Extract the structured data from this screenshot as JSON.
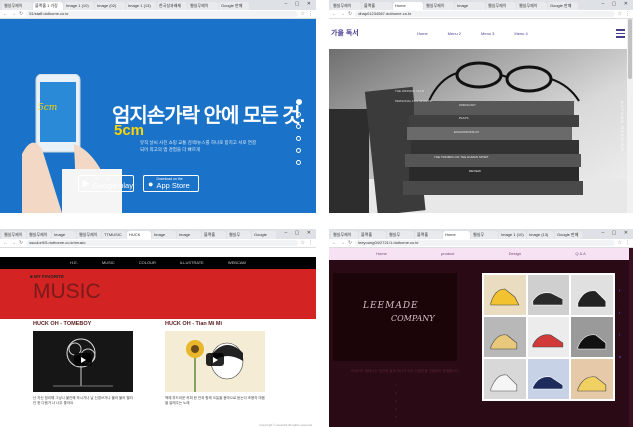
{
  "win1": {
    "tabs": [
      "웹실무제이",
      "블랙홀 1 가장",
      "Image 1 (10)",
      "Image (02)",
      "Image 1 (13)",
      "한국성과배제",
      "웹실무제이",
      "Google 판매"
    ],
    "url": "51/staff.dothome.co.kr",
    "brand": "5cm",
    "title": "엄지손가락 안에 모든 것.",
    "subtitle": "5cm",
    "desc": "뮤직 날씨 사진 쇼핑 교통 검색/뉴스를 하나로 합치고 서로 연결되어 최고의 앱 경험을 더 빠르게",
    "gp_small": "GET IT ON",
    "gp_big": "Google play",
    "as_small": "Download on the",
    "as_big": "App Store",
    "dots": 6,
    "colors": {
      "bg": "#1a73c9",
      "accent": "#ffd400"
    }
  },
  "win2": {
    "tabs": [
      "웹실무제이",
      "블랙홀",
      "Home",
      "웹실무제이",
      "Image",
      "웹실무제이",
      "웹실무제이",
      "Google 판매"
    ],
    "url": "dhap01234567.dothome.co.kr",
    "logo": "가을 독서",
    "menu": [
      "Home",
      "Menu 2",
      "Menu 3",
      "Menu 4"
    ],
    "side_text": "AUTUMN READING",
    "books": [
      {
        "title": "THE WINNING TEAM"
      },
      {
        "title": "PERSONAL FUN SPORTS"
      },
      {
        "title": "ZODOLOGY"
      },
      {
        "title": "PLAYS"
      },
      {
        "title": "EXCAVATIONS AT"
      },
      {
        "title": "THE TRIUMPH OF THE HUMAN SPIRIT"
      },
      {
        "title": "REVIEW"
      }
    ]
  },
  "win3": {
    "tabs": [
      "웹실무제이",
      "웹실무제이",
      "Image",
      "웹실무제이",
      "TTMUSIC",
      "HUCK",
      "Image",
      "Image",
      "블랙홀",
      "웹실무",
      "Google"
    ],
    "url": "sscolor9/5.dothome.co.kr/music",
    "menu": [
      "H.E.",
      "MUSIC",
      "COLOUR",
      "ILLUSTRATE",
      "WEBCAM"
    ],
    "fav": "■ MY FAVORITE",
    "music": "MUSIC",
    "left_title": "HUCK OH - TOMEBOY",
    "right_title": "HUCK OH - Tian Mi Mi",
    "left_text": "난 자신 정리해 그냥나 불안해 하시거나 날 신경쓰거나 불러 불러 빨리 안 한 다음거 너 너무 좋아요",
    "right_text": "책에 부드러운 커피 한 잔과 함께 오늘을 음악으로 듣는다 조용히 마음을 달래주는 노래",
    "footer": "Copyright © sscolor9 All rights reserved"
  },
  "win4": {
    "tabs": [
      "웹실무제이",
      "블랙홀",
      "웹실무",
      "블랙홀",
      "Home",
      "웹실무",
      "Image 1 (10)",
      "Image (13)",
      "Google 판매"
    ],
    "url": "leeyoung04/2721/1.dothome.co.kr",
    "menu": [
      "Home",
      "product",
      "Design",
      "Q & A"
    ],
    "logo1": "LEEMADE",
    "logo2": "COMPANY",
    "desc": "리메이드 컴퍼니는 당신의 발과 하나가 되는 신발만을 선별하여 판매합니다",
    "lines": [
      "1",
      "2",
      "3",
      "4",
      "5"
    ],
    "side": [
      "f",
      "t",
      "i",
      "b"
    ]
  }
}
